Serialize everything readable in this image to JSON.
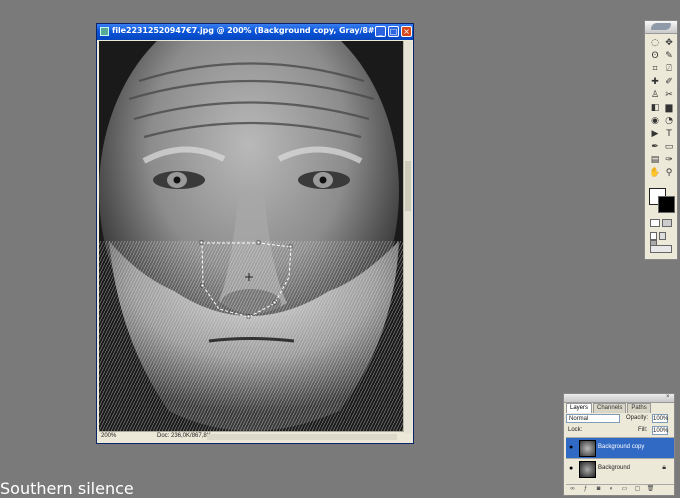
{
  "document": {
    "title": "file22312520947€7.jpg @ 200% (Background copy, Gray/8#)",
    "status_zoom": "200%",
    "status_doc": "Doc: 236,0K/867,8K"
  },
  "toolbox": {
    "tools": [
      "marquee-icon",
      "move-icon",
      "lasso-icon",
      "magic-wand-icon",
      "crop-icon",
      "slice-icon",
      "healing-brush-icon",
      "brush-icon",
      "clone-stamp-icon",
      "history-brush-icon",
      "eraser-icon",
      "gradient-icon",
      "blur-icon",
      "dodge-icon",
      "path-select-icon",
      "type-icon",
      "pen-icon",
      "shape-icon",
      "notes-icon",
      "eyedropper-icon",
      "hand-icon",
      "zoom-icon"
    ],
    "glyphs": [
      "◌",
      "✥",
      "ʘ",
      "✎",
      "⌗",
      "⍁",
      "✚",
      "✐",
      "♙",
      "✂",
      "◧",
      "▆",
      "◉",
      "◔",
      "▶",
      "T",
      "✒",
      "▭",
      "▤",
      "✑",
      "✋",
      "⚲"
    ]
  },
  "layers_panel": {
    "tabs": [
      "Layers",
      "Channels",
      "Paths"
    ],
    "blend_mode": "Normal",
    "opacity_label": "Opacity:",
    "opacity_value": "100%",
    "lock_label": "Lock:",
    "fill_label": "Fill:",
    "fill_value": "100%",
    "layers": [
      {
        "name": "Background copy",
        "selected": true
      },
      {
        "name": "Background",
        "selected": false
      }
    ]
  },
  "subtitle": "Southern silence",
  "colors": {
    "selection": "#316ac5",
    "titlebar": "#0a55d8",
    "workspace": "#7a7a7a"
  }
}
